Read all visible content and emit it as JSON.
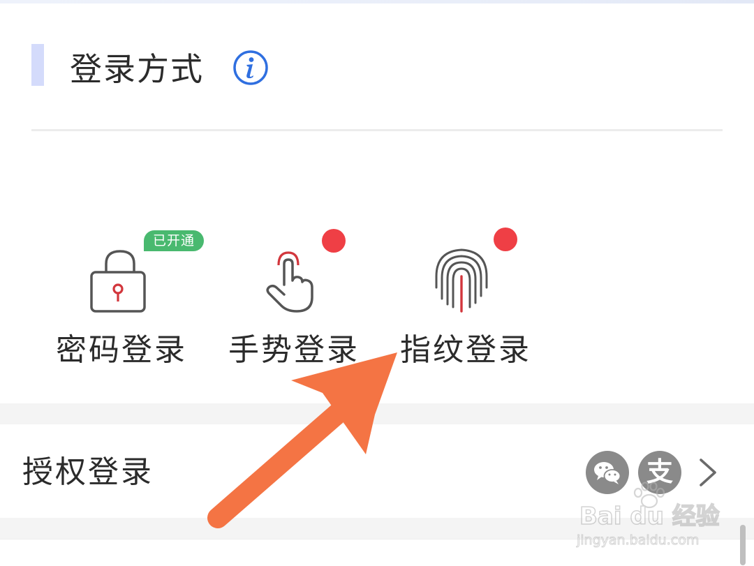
{
  "header": {
    "title": "登录方式",
    "info_icon": "info-circle-icon"
  },
  "methods": [
    {
      "label": "密码登录",
      "icon": "padlock-icon",
      "badge": "已开通"
    },
    {
      "label": "手势登录",
      "icon": "gesture-hand-icon",
      "badge_dot": true
    },
    {
      "label": "指纹登录",
      "icon": "fingerprint-icon",
      "badge_dot": true
    }
  ],
  "auth": {
    "label": "授权登录",
    "icons": [
      "wechat-icon",
      "alipay-icon"
    ],
    "alipay_glyph": "支",
    "chevron": "chevron-right-icon"
  },
  "watermark": {
    "brand": "Bai du 经验",
    "url": "jingyan.baidu.com"
  },
  "colors": {
    "accent_bar": "#d4dbfb",
    "info_blue": "#2f6fe0",
    "badge_green": "#49b96f",
    "dot_red": "#ef3f45",
    "arrow_orange": "#f47444",
    "icon_gray": "#8a8a8a"
  }
}
